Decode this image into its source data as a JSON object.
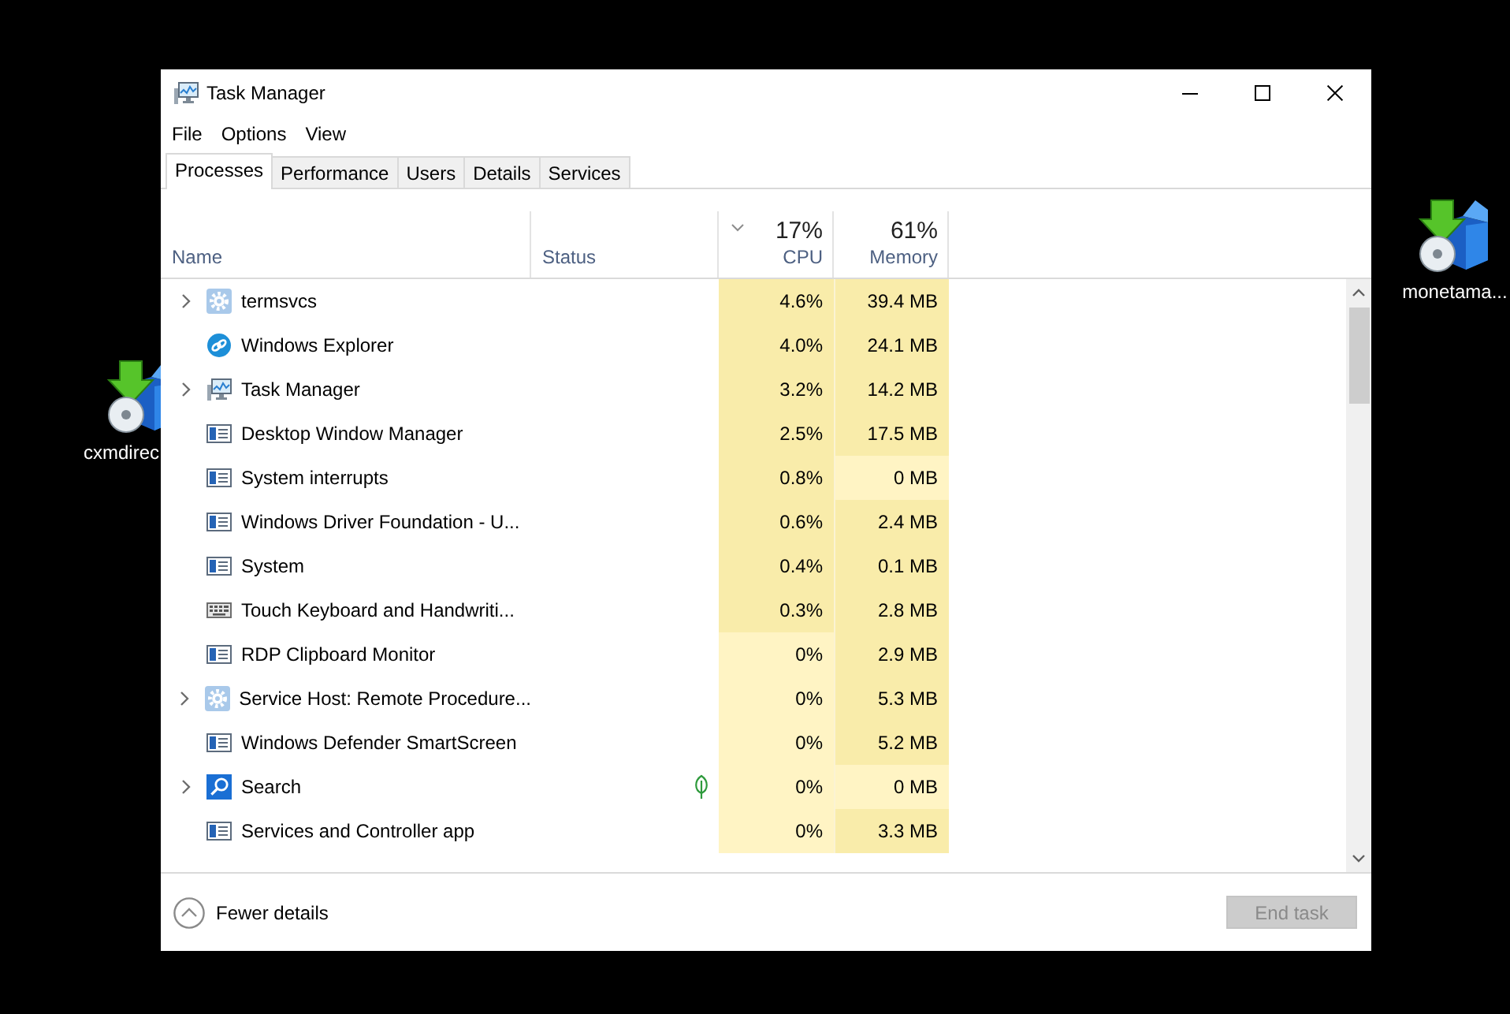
{
  "desktop_icons": [
    {
      "label": "cxmdirec"
    },
    {
      "label": "monetama..."
    }
  ],
  "window": {
    "title": "Task Manager"
  },
  "menu": [
    {
      "label": "File"
    },
    {
      "label": "Options"
    },
    {
      "label": "View"
    }
  ],
  "tabs": [
    {
      "label": "Processes",
      "selected": true
    },
    {
      "label": "Performance",
      "selected": false
    },
    {
      "label": "Users",
      "selected": false
    },
    {
      "label": "Details",
      "selected": false
    },
    {
      "label": "Services",
      "selected": false
    }
  ],
  "columns": [
    {
      "kind": "text",
      "label": "Name"
    },
    {
      "kind": "text",
      "label": "Status"
    },
    {
      "kind": "metric",
      "total": "17%",
      "label": "CPU",
      "sorted": true
    },
    {
      "kind": "metric",
      "total": "61%",
      "label": "Memory",
      "sorted": false
    }
  ],
  "rows": [
    {
      "name": "termsvcs",
      "kind": "gear",
      "expandable": true,
      "suspended": false,
      "cpu": "4.6%",
      "cpu_high": true,
      "memory": "39.4 MB",
      "memory_high": true
    },
    {
      "name": "Windows Explorer",
      "kind": "link",
      "expandable": false,
      "suspended": false,
      "cpu": "4.0%",
      "cpu_high": true,
      "memory": "24.1 MB",
      "memory_high": true
    },
    {
      "name": "Task Manager",
      "kind": "monitor",
      "expandable": true,
      "suspended": false,
      "cpu": "3.2%",
      "cpu_high": true,
      "memory": "14.2 MB",
      "memory_high": true
    },
    {
      "name": "Desktop Window Manager",
      "kind": "window",
      "expandable": false,
      "suspended": false,
      "cpu": "2.5%",
      "cpu_high": true,
      "memory": "17.5 MB",
      "memory_high": true
    },
    {
      "name": "System interrupts",
      "kind": "window",
      "expandable": false,
      "suspended": false,
      "cpu": "0.8%",
      "cpu_high": true,
      "memory": "0 MB",
      "memory_high": false
    },
    {
      "name": "Windows Driver Foundation - U...",
      "kind": "window",
      "expandable": false,
      "suspended": false,
      "cpu": "0.6%",
      "cpu_high": true,
      "memory": "2.4 MB",
      "memory_high": true
    },
    {
      "name": "System",
      "kind": "window",
      "expandable": false,
      "suspended": false,
      "cpu": "0.4%",
      "cpu_high": true,
      "memory": "0.1 MB",
      "memory_high": true
    },
    {
      "name": "Touch Keyboard and Handwriti...",
      "kind": "keyboard",
      "expandable": false,
      "suspended": false,
      "cpu": "0.3%",
      "cpu_high": true,
      "memory": "2.8 MB",
      "memory_high": true
    },
    {
      "name": "RDP Clipboard Monitor",
      "kind": "window",
      "expandable": false,
      "suspended": false,
      "cpu": "0%",
      "cpu_high": false,
      "memory": "2.9 MB",
      "memory_high": true
    },
    {
      "name": "Service Host: Remote Procedure...",
      "kind": "gear",
      "expandable": true,
      "suspended": false,
      "cpu": "0%",
      "cpu_high": false,
      "memory": "5.3 MB",
      "memory_high": true
    },
    {
      "name": "Windows Defender SmartScreen",
      "kind": "window",
      "expandable": false,
      "suspended": false,
      "cpu": "0%",
      "cpu_high": false,
      "memory": "5.2 MB",
      "memory_high": true
    },
    {
      "name": "Search",
      "kind": "search",
      "expandable": true,
      "suspended": true,
      "cpu": "0%",
      "cpu_high": false,
      "memory": "0 MB",
      "memory_high": false
    },
    {
      "name": "Services and Controller app",
      "kind": "window",
      "expandable": false,
      "suspended": false,
      "cpu": "0%",
      "cpu_high": false,
      "memory": "3.3 MB",
      "memory_high": true
    }
  ],
  "footer": {
    "details_toggle": "Fewer details",
    "end_task": {
      "label": "End task",
      "disabled": true
    }
  }
}
